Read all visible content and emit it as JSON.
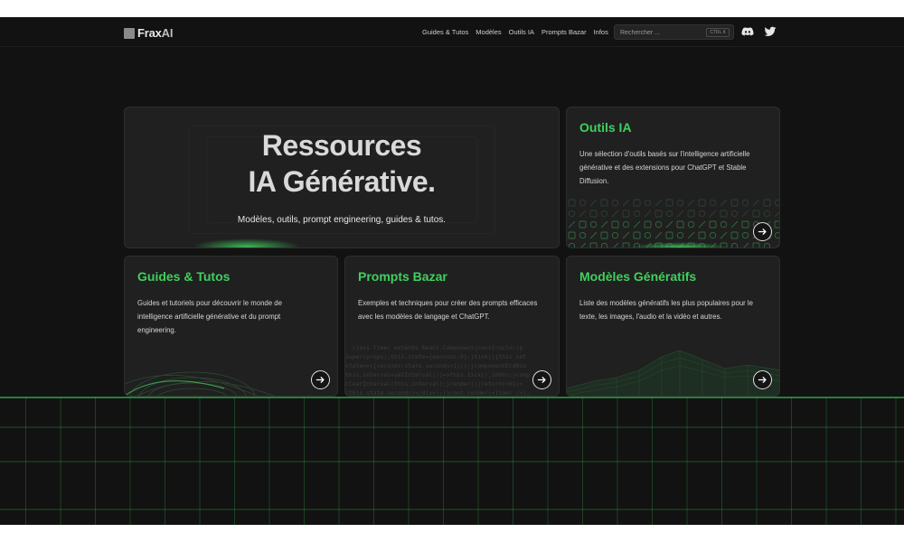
{
  "header": {
    "logo": {
      "text_a": "Frax",
      "text_b": "AI"
    },
    "nav": [
      "Guides & Tutos",
      "Modèles",
      "Outils IA",
      "Prompts Bazar",
      "Infos"
    ],
    "search": {
      "placeholder": "Rechercher ...",
      "shortcut": "CTRL K"
    },
    "social": [
      "discord-icon",
      "twitter-icon"
    ]
  },
  "hero": {
    "title_line1": "Ressources",
    "title_line2": "IA Générative.",
    "subtitle": "Modèles, outils, prompt engineering, guides & tutos."
  },
  "cards": {
    "outils": {
      "title": "Outils IA",
      "description": "Une sélection d'outils basés sur l'intelligence artificielle générative et des extensions pour ChatGPT et Stable Diffusion."
    },
    "guides": {
      "title": "Guides & Tutos",
      "description": "Guides et tutoriels pour découvrir le monde de intelligence artificielle générative et du prompt engineering."
    },
    "prompts": {
      "title": "Prompts Bazar",
      "description": "Exemples et techniques pour créer des prompts efficaces avec les modèles de langage et ChatGPT."
    },
    "modeles": {
      "title": "Modèles Génératifs",
      "description": "Liste des modèles génératifs les plus populaires pour le texte, les images, l'audio et la vidéo et autres."
    }
  },
  "colors": {
    "accent": "#3fd05d",
    "background": "#121212",
    "card": "#202020",
    "text": "#d6d6d6"
  },
  "icons": [
    "arrow-right-icon"
  ]
}
